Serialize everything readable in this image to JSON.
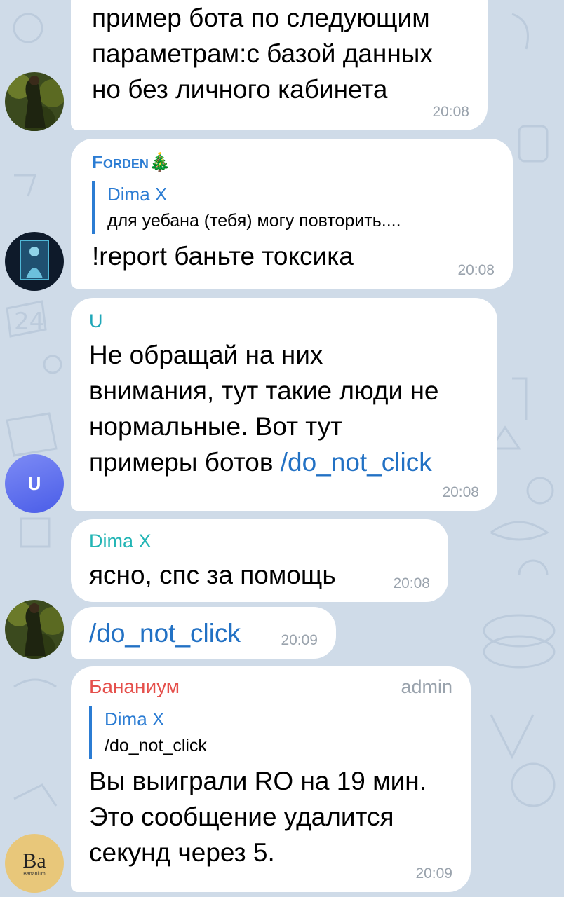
{
  "theme": {
    "background": "#cfdbe8",
    "bubble": "#ffffff",
    "link": "#2271c4",
    "time": "#9aa3ad",
    "name_forden": "#2b7cd3",
    "name_u": "#1fa7b8",
    "name_dima": "#23b5b5",
    "name_bananium": "#e5504c",
    "reply_bar": "#2b7cd3"
  },
  "messages": [
    {
      "id": "m1",
      "text_lines": [
        "пример бота по следующим",
        "параметрам:с базой данных",
        "но без личного кабинета"
      ],
      "time": "20:08",
      "avatar_icon": "forest-photo-avatar"
    },
    {
      "id": "m2",
      "sender": "Forden",
      "sender_emoji": "🎄",
      "reply": {
        "name": "Dima X",
        "text": "для уебана (тебя) могу повторить...."
      },
      "text": "!report баньте токсика",
      "time": "20:08",
      "avatar_icon": "dark-figure-avatar"
    },
    {
      "id": "m3",
      "sender": "U",
      "text_plain": "Не обращай на них\nвнимания, тут такие люди не\nнормальные. Вот тут\nпримеры ботов ",
      "text_link": "/do_not_click",
      "time": "20:08",
      "avatar_letter": "U"
    },
    {
      "id": "m4",
      "sender": "Dima X",
      "text": "ясно, спс за помощь",
      "time": "20:08"
    },
    {
      "id": "m5",
      "text_link": "/do_not_click",
      "time": "20:09",
      "avatar_icon": "forest-photo-avatar"
    },
    {
      "id": "m6",
      "sender": "Банaниум",
      "role": "admin",
      "reply": {
        "name": "Dima X",
        "text": "/do_not_click"
      },
      "text_lines": [
        "Вы выиграли RO на 19 мин.",
        "Это сообщение удалится",
        "секунд через 5."
      ],
      "time": "20:09",
      "avatar_text": "Ba",
      "avatar_subtext": "Bananium"
    }
  ]
}
